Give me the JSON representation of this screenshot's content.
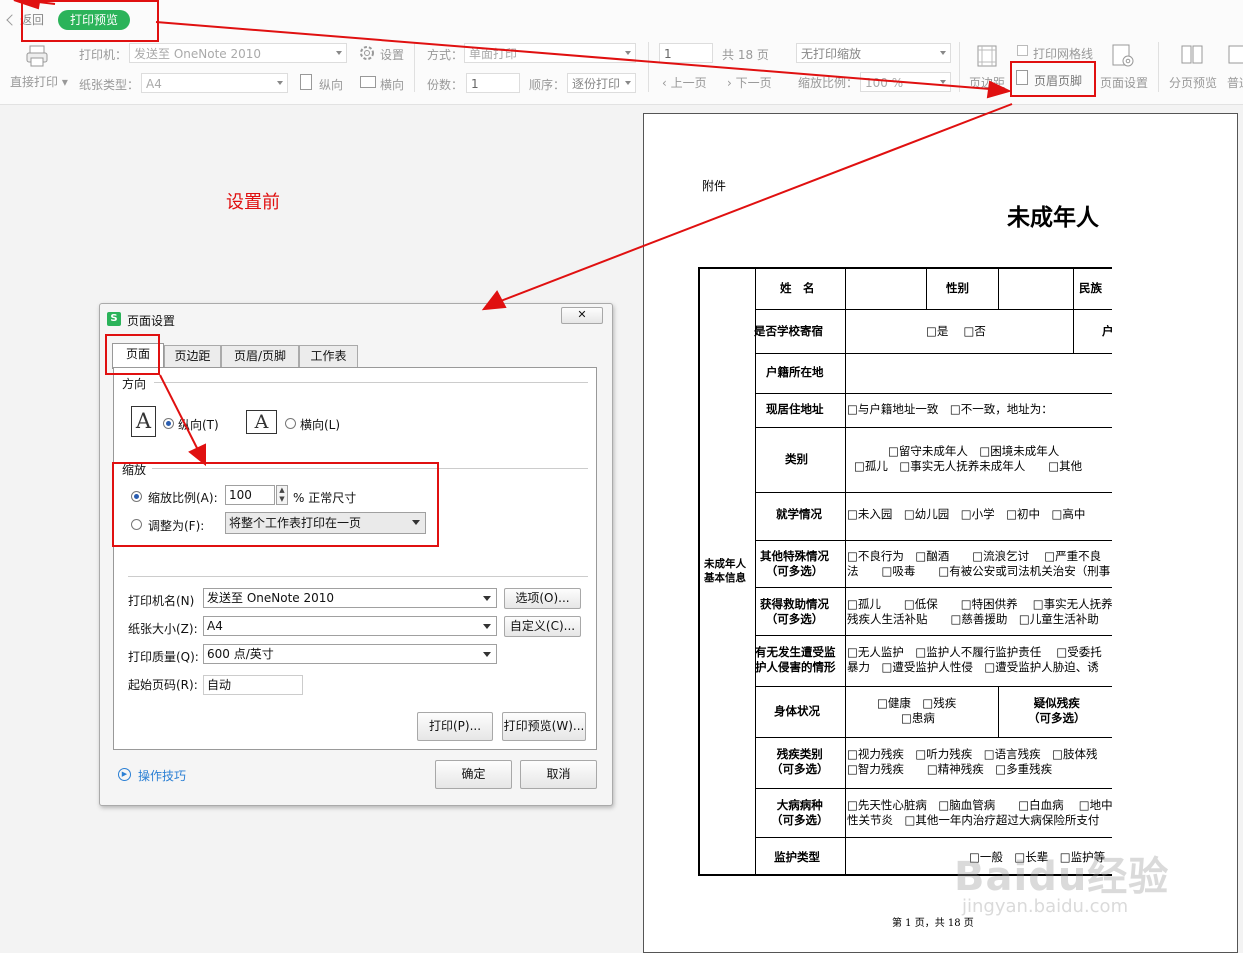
{
  "toolbar": {
    "back": "返回",
    "print_preview": "打印预览",
    "direct_print": "直接打印",
    "printer_label": "打印机：",
    "printer_value": "发送至 OneNote 2010",
    "settings": "设置",
    "paper_type_label": "纸张类型：",
    "paper_value": "A4",
    "portrait": "纵向",
    "landscape": "横向",
    "mode_label": "方式：",
    "mode_value": "单面打印",
    "copies_label": "份数：",
    "copies_value": "1",
    "order_label": "顺序：",
    "order_value": "逐份打印",
    "page_value": "1",
    "total_pages": "共 18 页",
    "prev_page": "上一页",
    "next_page": "下一页",
    "scale_value": "无打印缩放",
    "zoom_label": "缩放比例：",
    "zoom_value": "100 %",
    "print_grid": "打印网格线",
    "margins": "页边距",
    "header_footer": "页眉页脚",
    "page_setup": "页面设置",
    "page_break_preview": "分页预览",
    "normal": "普通"
  },
  "annotation": {
    "before_setting": "设置前"
  },
  "preview": {
    "attachment": "附件",
    "title": "未成年人",
    "page_footer": "第 1 页，共 18 页",
    "section_label": [
      "未成年人",
      "基本信息"
    ],
    "rows": [
      {
        "label": [
          "姓　名"
        ],
        "content": [
          "",
          "性别",
          "",
          "民族"
        ]
      },
      {
        "label": [
          "是否学校寄宿"
        ],
        "content": [
          "□是　 □否",
          "户"
        ]
      },
      {
        "label": [
          "户籍所在地"
        ],
        "content": [
          ""
        ]
      },
      {
        "label": [
          "现居住地址"
        ],
        "content": [
          "□与户籍地址一致　□不一致，地址为："
        ]
      },
      {
        "label": [
          "类别"
        ],
        "content": [
          "□留守未成年人　□困境未成年人",
          "□孤儿　□事实无人抚养未成年人　　□其他"
        ]
      },
      {
        "label": [
          "就学情况"
        ],
        "content": [
          "□未入园　□幼儿园　□小学　□初中　□高中"
        ]
      },
      {
        "label": [
          "其他特殊情况",
          "（可多选）"
        ],
        "content": [
          "□不良行为　□酗酒　　□流浪乞讨　 □严重不良",
          "法　　□吸毒　　□有被公安或司法机关治安（刑事"
        ]
      },
      {
        "label": [
          "获得救助情况",
          "（可多选）"
        ],
        "content": [
          "□孤儿　　□低保　　□特困供养　 □事实无人抚养",
          "残疾人生活补贴　　□慈善援助　□儿童生活补助　"
        ]
      },
      {
        "label": [
          "有无发生遭受监",
          "护人侵害的情形"
        ],
        "content": [
          "□无人监护　□监护人不履行监护责任　 □受委托",
          "暴力　□遭受监护人性侵　□遭受监护人胁迫、诱"
        ]
      },
      {
        "label": [
          "身体状况"
        ],
        "content": [
          "□健康　□残疾",
          "□患病",
          "疑似残疾",
          "（可多选）"
        ]
      },
      {
        "label": [
          "残疾类别",
          "（可多选）"
        ],
        "content": [
          "□视力残疾　□听力残疾　□语言残疾　□肢体残",
          "□智力残疾　　□精神残疾　□多重残疾"
        ]
      },
      {
        "label": [
          "大病病种",
          "（可多选）"
        ],
        "content": [
          "□先天性心脏病　□脑血管病　　□白血病　 □地中",
          "性关节炎　□其他一年内治疗超过大病保险所支付"
        ]
      },
      {
        "label": [
          "监护类型"
        ],
        "content": [
          "□一般　□长辈　□监护等"
        ]
      }
    ],
    "watermark": {
      "brand": "Baidu经验",
      "url": "jingyan.baidu.com"
    }
  },
  "dialog": {
    "title": "页面设置",
    "app_icon": "S",
    "tabs": [
      "页面",
      "页边距",
      "页眉/页脚",
      "工作表"
    ],
    "orientation_group": "方向",
    "portrait": "纵向(T)",
    "landscape": "横向(L)",
    "scaling_group": "缩放",
    "scale_ratio": "缩放比例(A):",
    "scale_value": "100",
    "scale_unit": "% 正常尺寸",
    "fit_to": "调整为(F):",
    "fit_value": "将整个工作表打印在一页",
    "printer_name_label": "打印机名(N)",
    "printer_name_value": "发送至 OneNote 2010",
    "options_btn": "选项(O)...",
    "paper_size_label": "纸张大小(Z):",
    "paper_size_value": "A4",
    "custom_btn": "自定义(C)...",
    "quality_label": "打印质量(Q):",
    "quality_value": "600 点/英寸",
    "start_page_label": "起始页码(R):",
    "start_page_value": "自动",
    "print_btn": "打印(P)...",
    "preview_btn": "打印预览(W)...",
    "tips_link": "操作技巧",
    "ok_btn": "确定",
    "cancel_btn": "取消"
  },
  "colors": {
    "annotation_red": "#e01010",
    "pill_green": "#2bb35a",
    "link_blue": "#2a7fd4"
  }
}
